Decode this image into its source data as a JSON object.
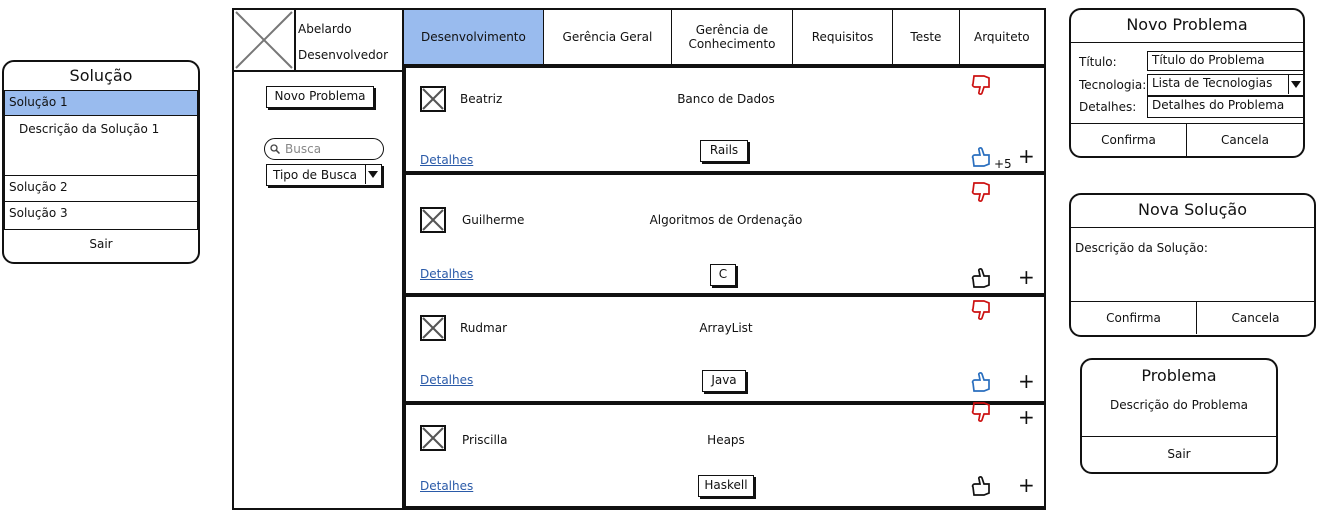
{
  "solution_panel": {
    "title": "Solução",
    "items": [
      {
        "label": "Solução 1",
        "selected": true,
        "description": "Descrição da Solução 1"
      },
      {
        "label": "Solução 2"
      },
      {
        "label": "Solução 3"
      }
    ],
    "exit_label": "Sair",
    "selected_color": "#99bbee"
  },
  "user": {
    "name": "Abelardo",
    "role": "Desenvolvedor",
    "avatar_icon": "image-placeholder-icon"
  },
  "sidebar": {
    "new_problem_label": "Novo Problema",
    "search_placeholder": "Busca",
    "search_type_label": "Tipo de Busca"
  },
  "tabs": [
    {
      "label": "Desenvolvimento",
      "active": true
    },
    {
      "label": "Gerência Geral"
    },
    {
      "label": "Gerência de Conhecimento"
    },
    {
      "label": "Requisitos"
    },
    {
      "label": "Teste"
    },
    {
      "label": "Arquiteto"
    }
  ],
  "problems": [
    {
      "author": "Beatriz",
      "title": "Banco de Dados",
      "tag": "Rails",
      "details": "Detalhes",
      "like_active": true,
      "like_count": "+5"
    },
    {
      "author": "Guilherme",
      "title": "Algoritmos de Ordenação",
      "tag": "C",
      "details": "Detalhes",
      "like_active": false,
      "like_count": ""
    },
    {
      "author": "Rudmar",
      "title": "ArrayList",
      "tag": "Java",
      "details": "Detalhes",
      "like_active": true,
      "like_count": ""
    },
    {
      "author": "Priscilla",
      "title": "Heaps",
      "tag": "Haskell",
      "details": "Detalhes",
      "like_active": false,
      "like_count": ""
    }
  ],
  "new_problem_dialog": {
    "title": "Novo Problema",
    "title_label": "Título:",
    "title_value": "Título do Problema",
    "tech_label": "Tecnologia:",
    "tech_value": "Lista de Tecnologias",
    "details_label": "Detalhes:",
    "details_value": "Detalhes do Problema",
    "confirm": "Confirma",
    "cancel": "Cancela"
  },
  "new_solution_dialog": {
    "title": "Nova Solução",
    "description_label": "Descrição da Solução:",
    "confirm": "Confirma",
    "cancel": "Cancela"
  },
  "problem_dialog": {
    "title": "Problema",
    "description": "Descrição do Problema",
    "exit": "Sair"
  },
  "colors": {
    "accent": "#99bbee",
    "link": "#2a5aa8",
    "like": "#2a6fbf",
    "dislike": "#cc1111"
  }
}
